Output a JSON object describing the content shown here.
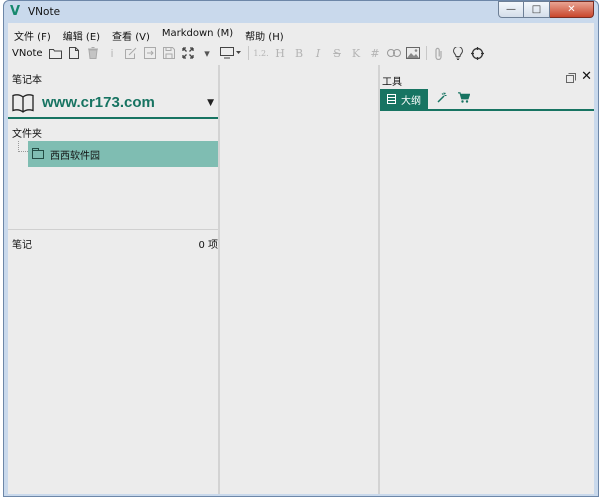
{
  "window": {
    "title": "VNote",
    "logo": "V",
    "controls": {
      "minimize": "—",
      "maximize": "□",
      "close": "✕"
    }
  },
  "menubar": {
    "items": [
      "文件 (F)",
      "编辑 (E)",
      "查看 (V)",
      "Markdown (M)",
      "帮助 (H)"
    ]
  },
  "toolbar": {
    "label": "VNote",
    "icons": [
      "folder-icon",
      "new-file-icon",
      "delete-icon",
      "info-icon",
      "edit-icon",
      "import-icon",
      "save-icon",
      "expand-icon",
      "monitor-icon",
      "heading-icon",
      "h-icon",
      "bold-icon",
      "italic-icon",
      "strikethrough-icon",
      "k-icon",
      "hash-icon",
      "link-icon",
      "image-icon",
      "attach-icon",
      "bulb-icon",
      "target-icon"
    ],
    "format_glyphs": {
      "heading": "1.2.",
      "h": "H",
      "bold": "B",
      "italic": "I",
      "strike": "S",
      "k": "K",
      "hash": "#"
    }
  },
  "left_panel": {
    "notebook_header": "笔记本",
    "notebook_name": "www.cr173.com",
    "folders_header": "文件夹",
    "folders": [
      {
        "name": "西西软件园",
        "selected": true
      }
    ],
    "notes_header": "笔记",
    "notes_count": "0 项"
  },
  "right_panel": {
    "title": "工具",
    "tabs": [
      {
        "label": "大纲",
        "icon": "outline-icon",
        "active": true
      },
      {
        "label": "",
        "icon": "magic-wand-icon",
        "active": false
      },
      {
        "label": "",
        "icon": "cart-icon",
        "active": false
      }
    ]
  },
  "colors": {
    "accent": "#177462",
    "selection": "#7fbdb2",
    "background": "#ececec",
    "frame": "#c9d9ec"
  }
}
